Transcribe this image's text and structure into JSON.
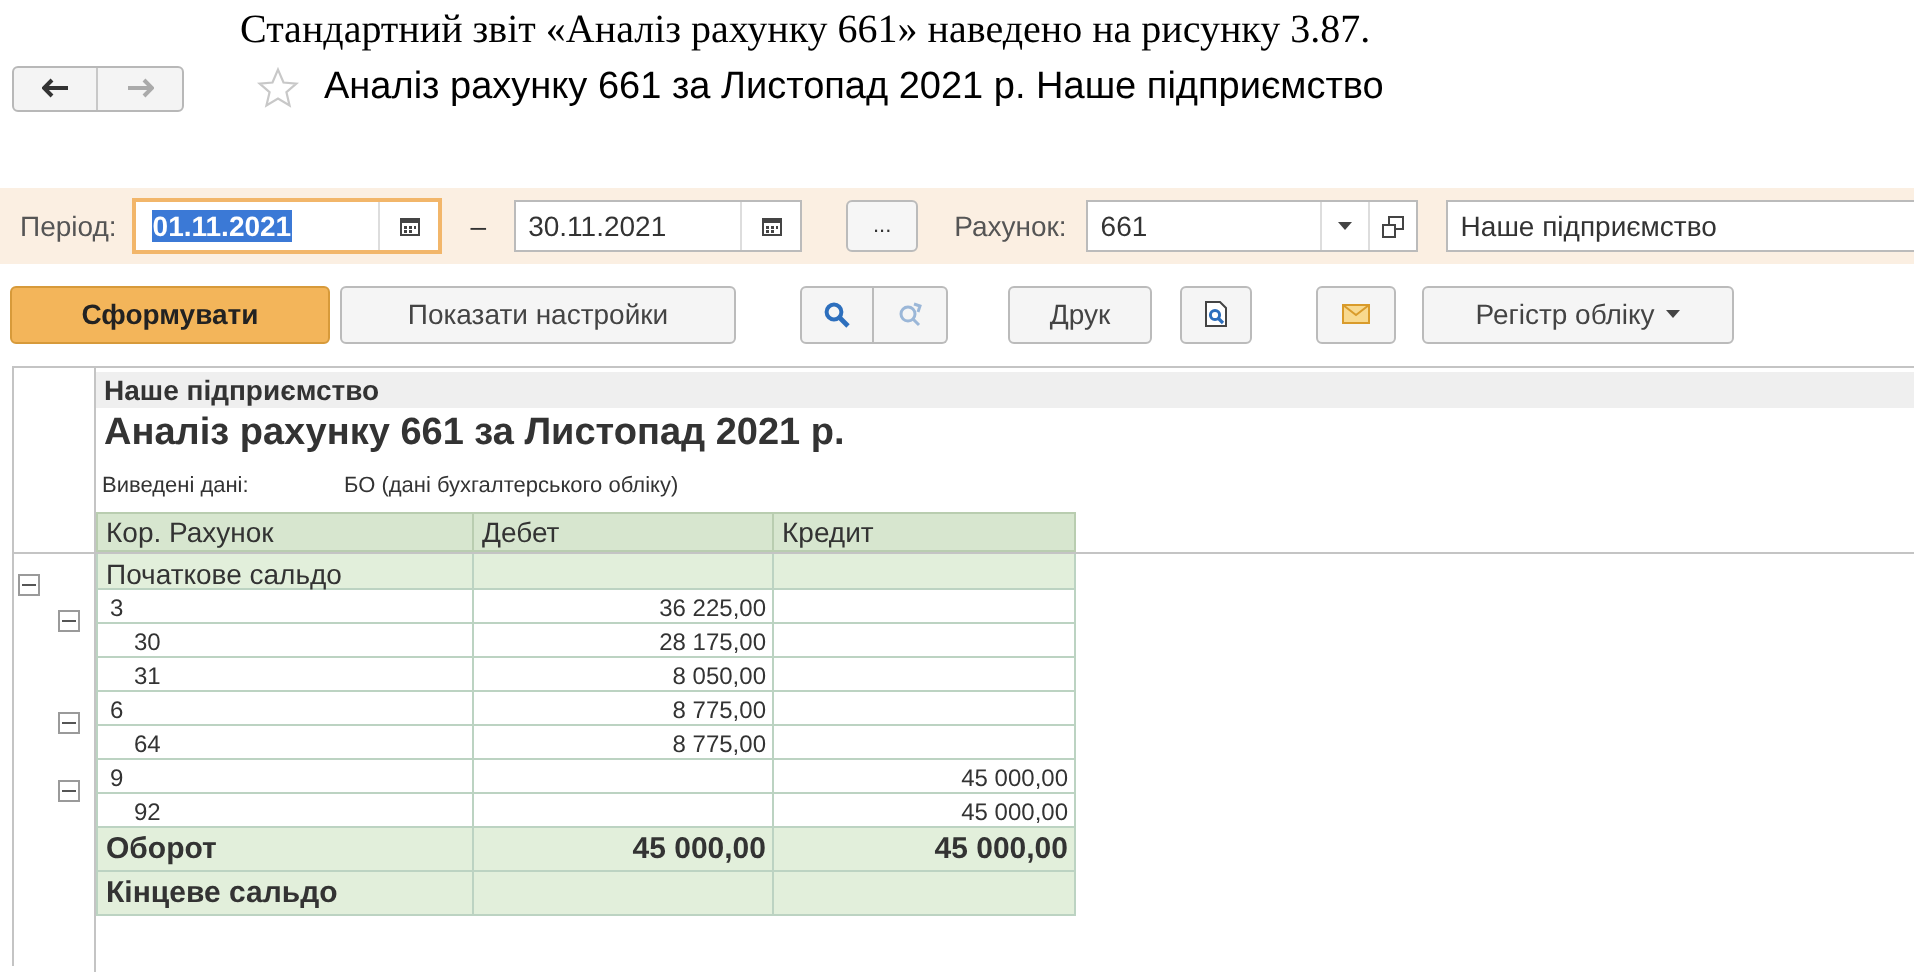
{
  "caption": "Стандартний звіт «Аналіз рахунку 661» наведено на рисунку 3.87.",
  "window": {
    "title": "Аналіз рахунку 661 за Листопад 2021 р. Наше підприємство",
    "favorite": false
  },
  "filters": {
    "period_label": "Період:",
    "date_from": "01.11.2021",
    "dash": "–",
    "date_to": "30.11.2021",
    "more_button": "...",
    "account_label": "Рахунок:",
    "account": "661",
    "organization": "Наше підприємство"
  },
  "toolbar": {
    "generate": "Сформувати",
    "show_settings": "Показати настройки",
    "print": "Друк",
    "register": "Регістр обліку"
  },
  "report": {
    "organization": "Наше підприємство",
    "title": "Аналіз рахунку 661 за Листопад 2021 р.",
    "output_label": "Виведені дані:",
    "output_value": "БО (дані бухгалтерського обліку)",
    "columns": [
      "Кор. Рахунок",
      "Дебет",
      "Кредит"
    ],
    "rows": [
      {
        "kind": "group",
        "label": "Початкове сальдо",
        "expanded": true,
        "children": [
          {
            "kind": "account",
            "label": "3",
            "debit": "36 225,00",
            "expanded": true,
            "children": [
              {
                "kind": "account",
                "label": "30",
                "debit": "28 175,00"
              },
              {
                "kind": "account",
                "label": "31",
                "debit": "8 050,00"
              }
            ]
          },
          {
            "kind": "account",
            "label": "6",
            "debit": "8 775,00",
            "expanded": true,
            "children": [
              {
                "kind": "account",
                "label": "64",
                "debit": "8 775,00"
              }
            ]
          },
          {
            "kind": "account",
            "label": "9",
            "credit": "45 000,00",
            "expanded": true,
            "children": [
              {
                "kind": "account",
                "label": "92",
                "credit": "45 000,00"
              }
            ]
          }
        ]
      },
      {
        "kind": "total",
        "label": "Оборот",
        "debit": "45 000,00",
        "credit": "45 000,00"
      },
      {
        "kind": "total",
        "label": "Кінцеве сальдо"
      }
    ]
  }
}
